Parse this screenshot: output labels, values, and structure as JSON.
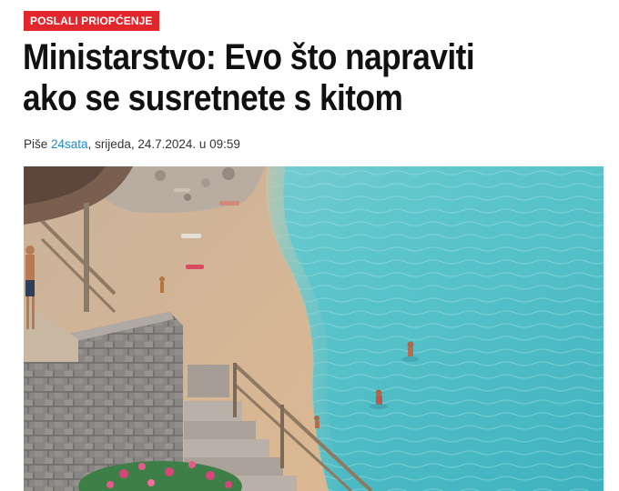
{
  "article": {
    "category": "POSLALI PRIOPĆENJE",
    "title": "Ministarstvo: Evo što napraviti ako se susretnete s kitom",
    "byline": {
      "prefix": "Piše ",
      "author": "24sata",
      "date": ", srijeda, 24.7.2024. u 09:59"
    },
    "image": {
      "icon": "beach-photo"
    }
  },
  "colors": {
    "badge": "#e3262c",
    "author_link": "#1a8ad4",
    "headline": "#111111",
    "sea": "#5cc6cc",
    "sand": "#d9b894"
  }
}
